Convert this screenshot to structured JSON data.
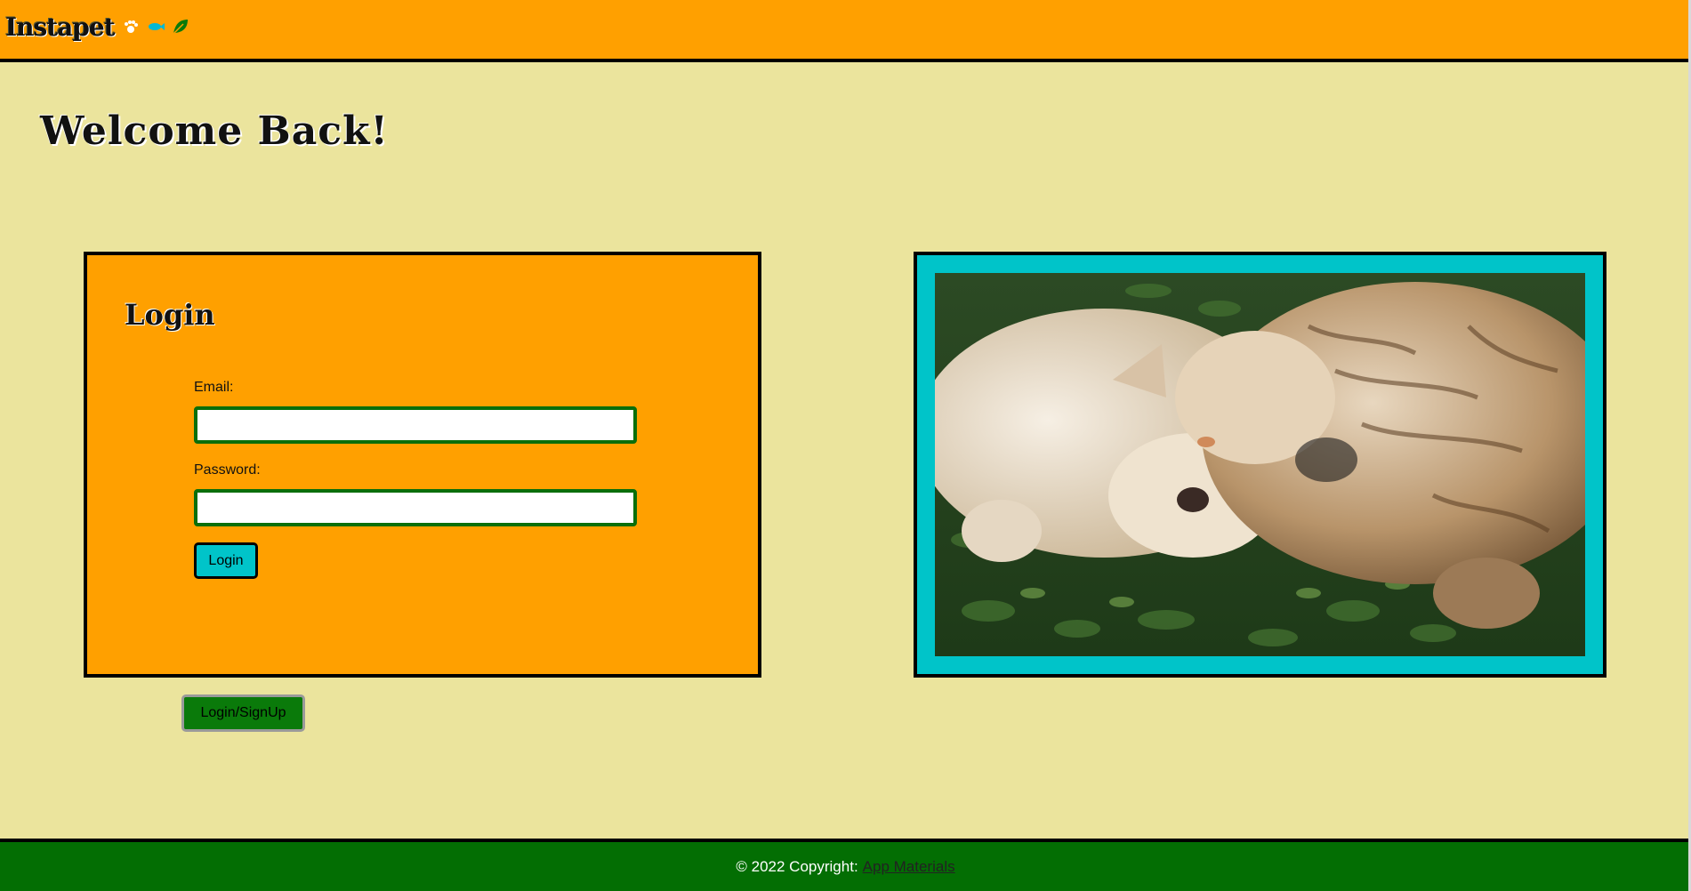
{
  "header": {
    "brand": "Instapet",
    "icons": [
      "paw-icon",
      "fish-icon",
      "leaf-icon"
    ],
    "background": "#ffa000"
  },
  "main": {
    "welcome": "Welcome Back!"
  },
  "login_card": {
    "title": "Login",
    "email_label": "Email:",
    "email_value": "",
    "password_label": "Password:",
    "password_value": "",
    "login_button": "Login"
  },
  "photo": {
    "subject": "cat-and-dog-photo",
    "frame_color": "#00c4c9"
  },
  "signup_button": "Login/SignUp",
  "footer": {
    "copyright": "© 2022 Copyright:",
    "link": "App Materials"
  },
  "colors": {
    "page": "#ebe49d",
    "accent_orange": "#ffa000",
    "accent_teal": "#00c4c9",
    "accent_green": "#0a7a0a"
  }
}
